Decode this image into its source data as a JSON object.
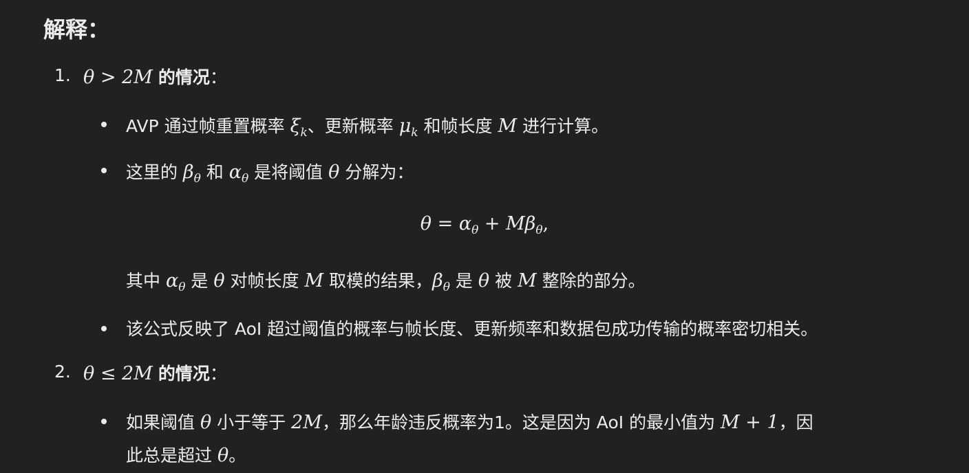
{
  "heading": "解释：",
  "items": [
    {
      "number": "1.",
      "title_math": "θ > 2M",
      "title_text": "的情况",
      "title_colon": "：",
      "bullets": [
        {
          "p1": "AVP 通过帧重置概率 ",
          "m1": "ξ",
          "m1_sub": "k",
          "p2": "、更新概率 ",
          "m2": "μ",
          "m2_sub": "k",
          "p3": " 和帧长度 ",
          "m3": "M",
          "p4": " 进行计算。"
        },
        {
          "p1": "这里的 ",
          "m1": "β",
          "m1_sub": "θ",
          "p2": " 和 ",
          "m2": "α",
          "m2_sub": "θ",
          "p3": " 是将阈值 ",
          "m3": "θ",
          "p4": " 分解为："
        }
      ],
      "equation": {
        "lhs": "θ",
        "eq": " = ",
        "a": "α",
        "a_sub": "θ",
        "plus": " + ",
        "m": "Mβ",
        "m_sub": "θ",
        "end": ","
      },
      "after_eq": {
        "p1": "其中 ",
        "m1": "α",
        "m1_sub": "θ",
        "p2": " 是 ",
        "m2": "θ",
        "p3": " 对帧长度 ",
        "m3": "M",
        "p4": " 取模的结果，",
        "m4": "β",
        "m4_sub": "θ",
        "p5": " 是 ",
        "m5": "θ",
        "p6": " 被 ",
        "m6": "M",
        "p7": " 整除的部分。"
      },
      "bullet3": "该公式反映了 AoI 超过阈值的概率与帧长度、更新频率和数据包成功传输的概率密切相关。"
    },
    {
      "number": "2.",
      "title_math": "θ ≤ 2M",
      "title_text": "的情况",
      "title_colon": "：",
      "bullet": {
        "p1": "如果阈值 ",
        "m1": "θ",
        "p2": " 小于等于 ",
        "m2": "2M",
        "p3": "，那么年龄违反概率为1。这是因为 AoI 的最小值为 ",
        "m3": "M + 1",
        "p4": "，因",
        "line2_p1": "此总是超过 ",
        "line2_m1": "θ",
        "line2_p2": "。"
      }
    }
  ]
}
